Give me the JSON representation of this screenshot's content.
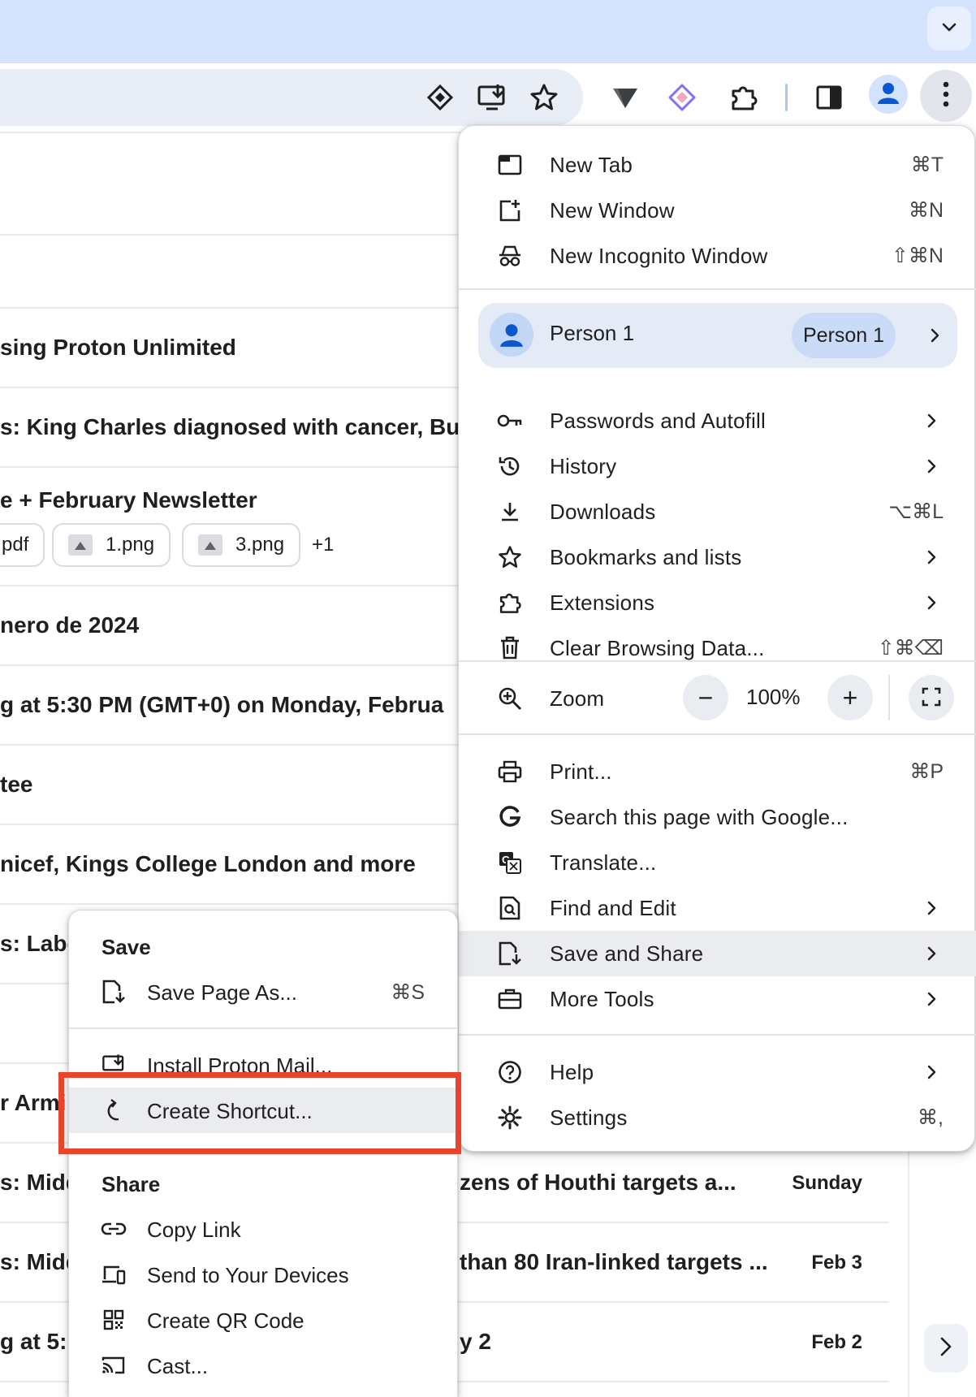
{
  "browser": {
    "icons": [
      "chevron-down-icon",
      "translate-lens-icon",
      "install-app-icon",
      "bookmark-star-icon",
      "vpn-icon",
      "proton-pass-icon",
      "extensions-puzzle-icon",
      "side-panel-icon",
      "profile-icon",
      "kebab-menu-icon"
    ]
  },
  "mail": {
    "rows": [
      {
        "subject": ""
      },
      {
        "subject": ""
      },
      {
        "subject": "sing Proton Unlimited"
      },
      {
        "subject": "s: King Charles diagnosed with cancer, Bu"
      },
      {
        "subject": "e + February Newsletter"
      },
      {
        "subject": "nero de 2024"
      },
      {
        "subject": "g at 5:30 PM (GMT+0) on Monday, Februa"
      },
      {
        "subject": "tee"
      },
      {
        "subject": "nicef, Kings College London and more"
      },
      {
        "subject": "s: Labo"
      },
      {
        "subject": ""
      },
      {
        "subject": "r Armi"
      },
      {
        "subject": "s: Midd",
        "subject_right": "zens of Houthi targets a...",
        "date": "Sunday"
      },
      {
        "subject": "s: Midd",
        "subject_right": "than 80 Iran-linked targets ...",
        "date": "Feb 3"
      },
      {
        "subject": "g at 5:",
        "subject_right": "y 2",
        "date": "Feb 2"
      }
    ],
    "attachments": [
      {
        "name": "pdf"
      },
      {
        "name": "1.png"
      },
      {
        "name": "3.png"
      }
    ],
    "more_attachments": "+1"
  },
  "main_menu": {
    "new_tab": {
      "label": "New Tab",
      "shortcut": "⌘T"
    },
    "new_window": {
      "label": "New Window",
      "shortcut": "⌘N"
    },
    "incognito": {
      "label": "New Incognito Window",
      "shortcut": "⇧⌘N"
    },
    "profile": {
      "name": "Person 1",
      "pill": "Person 1"
    },
    "passwords": {
      "label": "Passwords and Autofill"
    },
    "history": {
      "label": "History"
    },
    "downloads": {
      "label": "Downloads",
      "shortcut": "⌥⌘L"
    },
    "bookmarks": {
      "label": "Bookmarks and lists"
    },
    "extensions": {
      "label": "Extensions"
    },
    "clear_data": {
      "label": "Clear Browsing Data...",
      "shortcut": "⇧⌘⌫"
    },
    "zoom": {
      "label": "Zoom",
      "minus": "−",
      "value": "100%",
      "plus": "+"
    },
    "print": {
      "label": "Print...",
      "shortcut": "⌘P"
    },
    "search_google": {
      "label": "Search this page with Google..."
    },
    "translate": {
      "label": "Translate..."
    },
    "find_edit": {
      "label": "Find and Edit"
    },
    "save_share": {
      "label": "Save and Share"
    },
    "more_tools": {
      "label": "More Tools"
    },
    "help": {
      "label": "Help"
    },
    "settings": {
      "label": "Settings",
      "shortcut": "⌘,"
    }
  },
  "save_share_menu": {
    "save_heading": "Save",
    "save_page": {
      "label": "Save Page As...",
      "shortcut": "⌘S"
    },
    "install": {
      "label": "Install Proton Mail..."
    },
    "create_shortcut": {
      "label": "Create Shortcut..."
    },
    "share_heading": "Share",
    "copy_link": {
      "label": "Copy Link"
    },
    "send_devices": {
      "label": "Send to Your Devices"
    },
    "qr_code": {
      "label": "Create QR Code"
    },
    "cast": {
      "label": "Cast..."
    }
  },
  "colors": {
    "tabstrip": "#d3e3fd",
    "accent_blue": "#0b57d0",
    "highlight_red": "#e8442c"
  }
}
